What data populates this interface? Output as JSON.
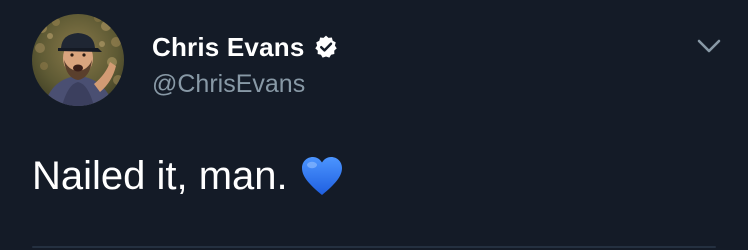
{
  "tweet": {
    "display_name": "Chris Evans",
    "handle": "@ChrisEvans",
    "text": "Nailed it, man.",
    "emoji": "blue-heart",
    "verified": true
  },
  "icons": {
    "verified": "verified-badge-icon",
    "menu": "chevron-down-icon",
    "emoji": "blue-heart-icon"
  },
  "colors": {
    "background": "#141b27",
    "primary_text": "#ffffff",
    "secondary_text": "#8899a6",
    "heart": "#2f7cf6"
  }
}
